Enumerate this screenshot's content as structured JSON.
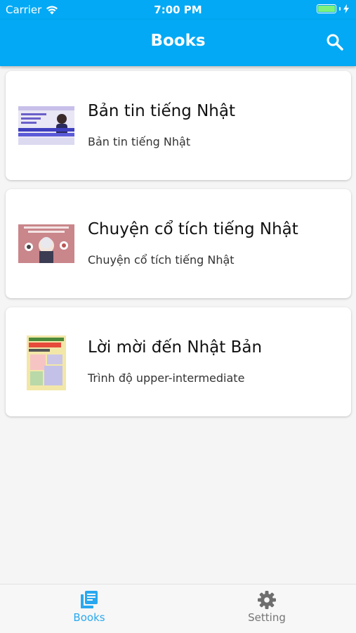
{
  "status_bar": {
    "carrier": "Carrier",
    "time": "7:00 PM"
  },
  "app_bar": {
    "title": "Books",
    "search_icon": "search-icon"
  },
  "books": [
    {
      "title": "Bản tin tiếng Nhật",
      "subtitle": "Bản tin tiếng Nhật"
    },
    {
      "title": "Chuyện cổ tích tiếng Nhật",
      "subtitle": "Chuyện cổ tích tiếng Nhật"
    },
    {
      "title": "Lời mời đến Nhật Bản",
      "subtitle": "Trình độ upper-intermediate"
    }
  ],
  "bottom_nav": [
    {
      "label": "Books",
      "icon": "books-icon",
      "active": true
    },
    {
      "label": "Setting",
      "icon": "gear-icon",
      "active": false
    }
  ],
  "colors": {
    "primary": "#03a9f4",
    "active_tab": "#29a8ef",
    "inactive_tab": "#757575"
  }
}
